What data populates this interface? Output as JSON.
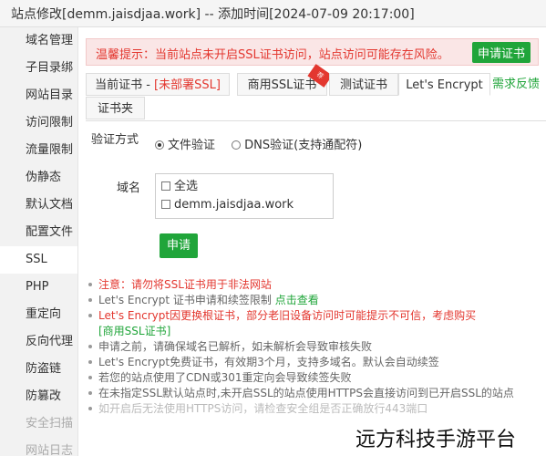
{
  "title": "站点修改[demm.jaisdjaa.work] -- 添加时间[2024-07-09 20:17:00]",
  "sidebar": {
    "items": [
      {
        "label": "域名管理"
      },
      {
        "label": "子目录绑"
      },
      {
        "label": "网站目录"
      },
      {
        "label": "访问限制"
      },
      {
        "label": "流量限制"
      },
      {
        "label": "伪静态"
      },
      {
        "label": "默认文档"
      },
      {
        "label": "配置文件"
      },
      {
        "label": "SSL"
      },
      {
        "label": "PHP"
      },
      {
        "label": "重定向"
      },
      {
        "label": "反向代理"
      },
      {
        "label": "防盗链"
      },
      {
        "label": "防篡改"
      },
      {
        "label": "安全扫描"
      },
      {
        "label": "网站日志"
      }
    ]
  },
  "warning": {
    "text": "温馨提示：当前站点未开启SSL证书访问，站点访问可能存在风险。",
    "button": "申请证书"
  },
  "tabs": {
    "current": "当前证书 - ",
    "current_status": "[未部署SSL]",
    "commercial": "商用SSL证书",
    "test": "测试证书",
    "letsencrypt": "Let's Encrypt",
    "folder": "证书夹",
    "feedback": "需求反馈"
  },
  "form": {
    "verify_label": "验证方式",
    "verify_options": [
      "文件验证",
      "DNS验证(支持通配符)"
    ],
    "domain_label": "域名",
    "domain_options": [
      "全选",
      "demm.jaisdjaa.work"
    ],
    "apply": "申请"
  },
  "notes": {
    "n1": "注意：请勿将SSL证书用于非法网站",
    "n2_prefix": "Let's Encrypt 证书申请和续签限制 ",
    "n2_link": "点击查看",
    "n3": "Let's Encrypt因更换根证书，部分老旧设备访问时可能提示不可信，考虑购买",
    "n3_link": "[商用SSL证书]",
    "n4": "申请之前，请确保域名已解析，如未解析会导致审核失败",
    "n5": "Let's Encrypt免费证书，有效期3个月，支持多域名。默认会自动续签",
    "n6": "若您的站点使用了CDN或301重定向会导致续签失败",
    "n7": "在未指定SSL默认站点时,未开启SSL的站点使用HTTPS会直接访问到已开启SSL的站点",
    "n8": "如开启后无法使用HTTPS访问，请检查安全组是否正确放行443端口"
  },
  "watermark": "远方科技手游平台",
  "colors": {
    "accent": "#20a53a",
    "danger": "#e3372f",
    "warning_bg": "#fae6e6"
  }
}
